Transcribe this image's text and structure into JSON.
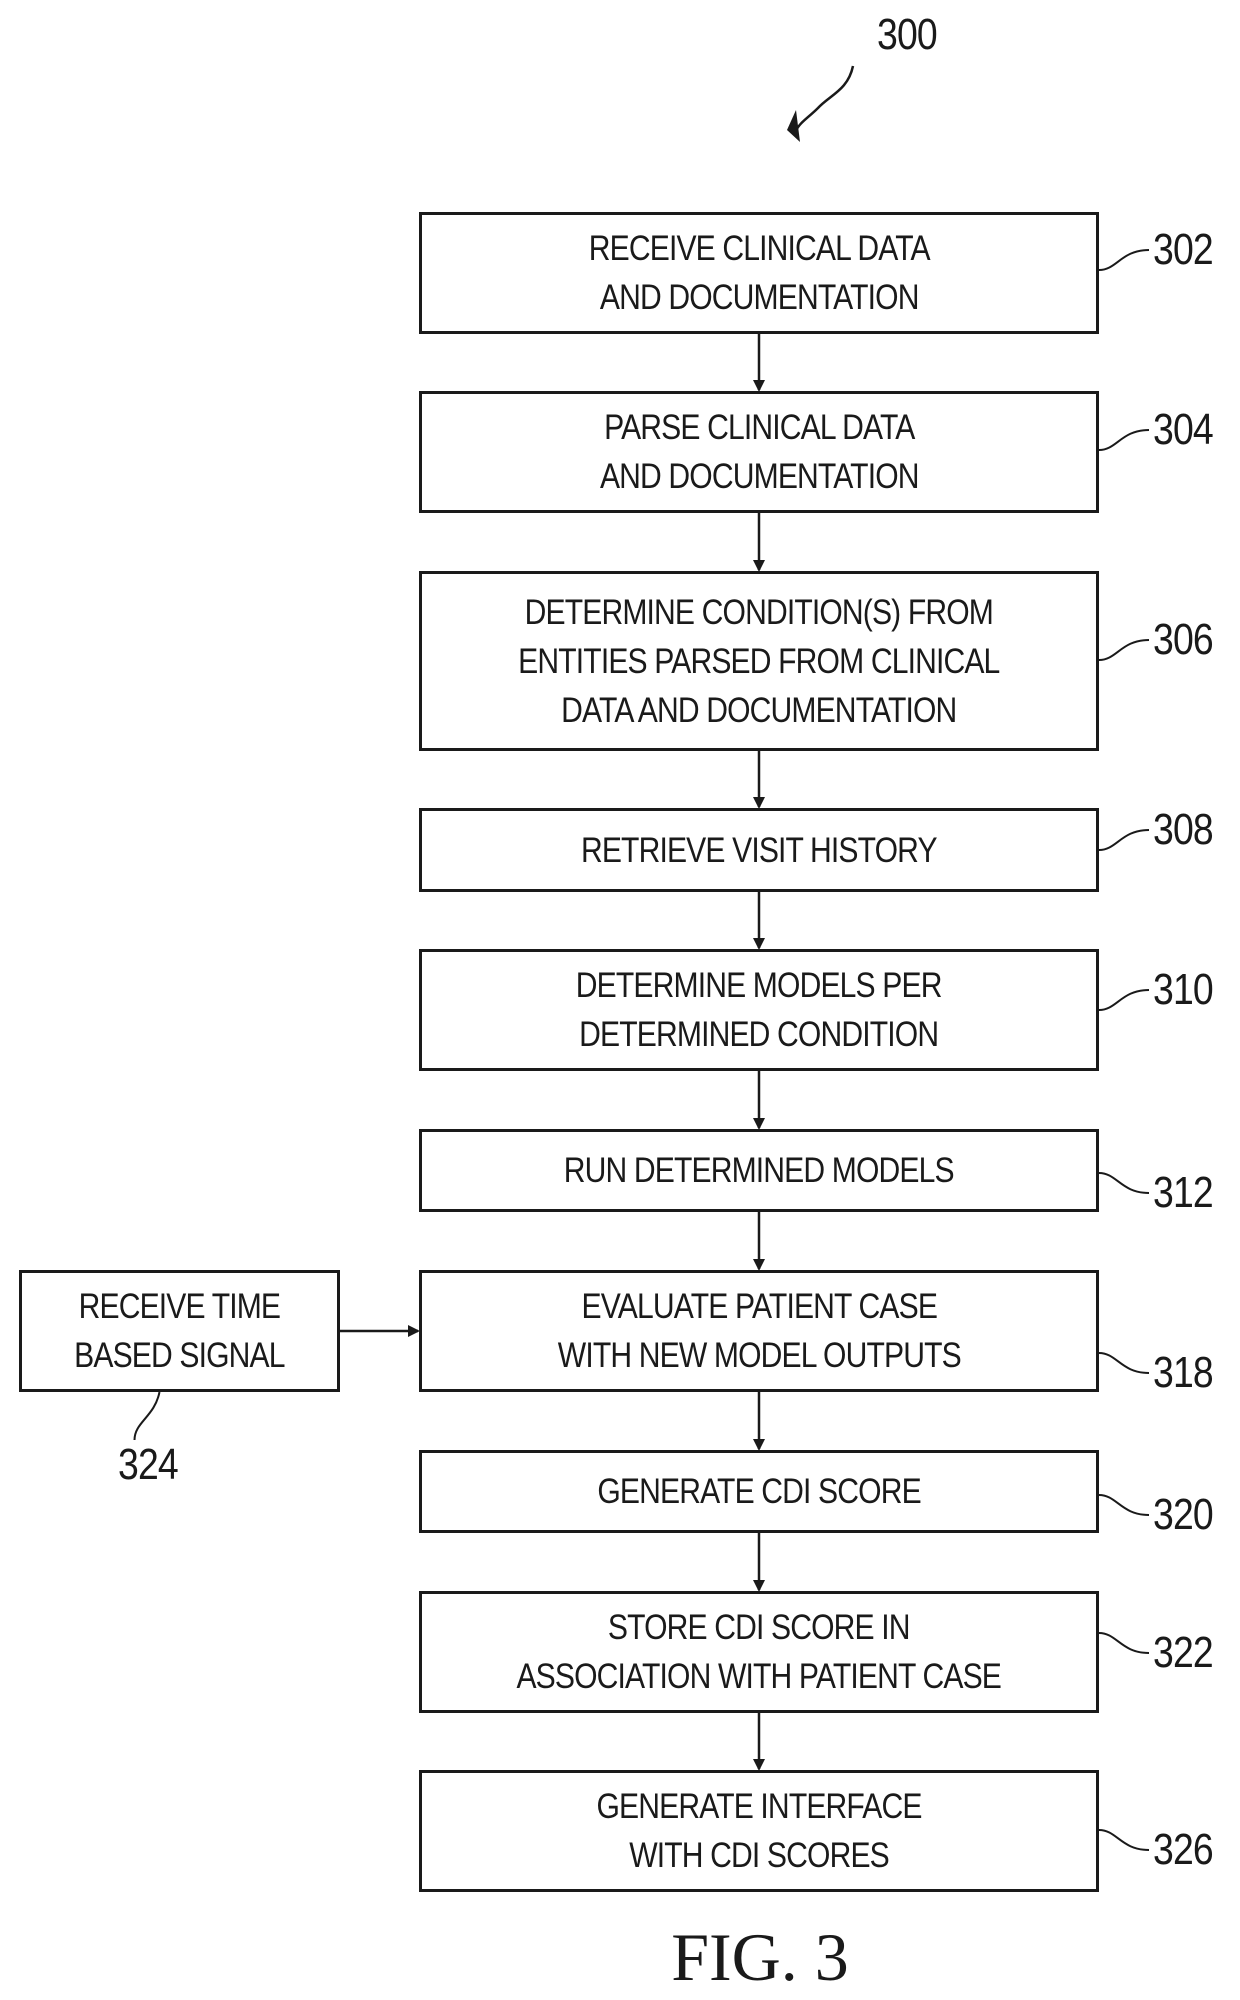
{
  "figure": {
    "ref": "300",
    "caption": "FIG. 3"
  },
  "steps": [
    {
      "id": "302",
      "label": "RECEIVE CLINICAL DATA\nAND DOCUMENTATION"
    },
    {
      "id": "304",
      "label": "PARSE CLINICAL DATA\nAND DOCUMENTATION"
    },
    {
      "id": "306",
      "label": "DETERMINE CONDITION(S) FROM\nENTITIES PARSED FROM CLINICAL\nDATA AND DOCUMENTATION"
    },
    {
      "id": "308",
      "label": "RETRIEVE VISIT HISTORY"
    },
    {
      "id": "310",
      "label": "DETERMINE MODELS PER\nDETERMINED CONDITION"
    },
    {
      "id": "312",
      "label": "RUN DETERMINED MODELS"
    },
    {
      "id": "318",
      "label": "EVALUATE PATIENT CASE\nWITH NEW MODEL OUTPUTS"
    },
    {
      "id": "320",
      "label": "GENERATE CDI SCORE"
    },
    {
      "id": "322",
      "label": "STORE CDI SCORE IN\nASSOCIATION WITH PATIENT CASE"
    },
    {
      "id": "326",
      "label": "GENERATE INTERFACE\nWITH CDI SCORES"
    }
  ],
  "side_input": {
    "id": "324",
    "label": "RECEIVE TIME\nBASED SIGNAL",
    "target": "318"
  },
  "edges": [
    [
      "302",
      "304"
    ],
    [
      "304",
      "306"
    ],
    [
      "306",
      "308"
    ],
    [
      "308",
      "310"
    ],
    [
      "310",
      "312"
    ],
    [
      "312",
      "318"
    ],
    [
      "318",
      "320"
    ],
    [
      "320",
      "322"
    ],
    [
      "322",
      "326"
    ],
    [
      "324",
      "318"
    ]
  ]
}
